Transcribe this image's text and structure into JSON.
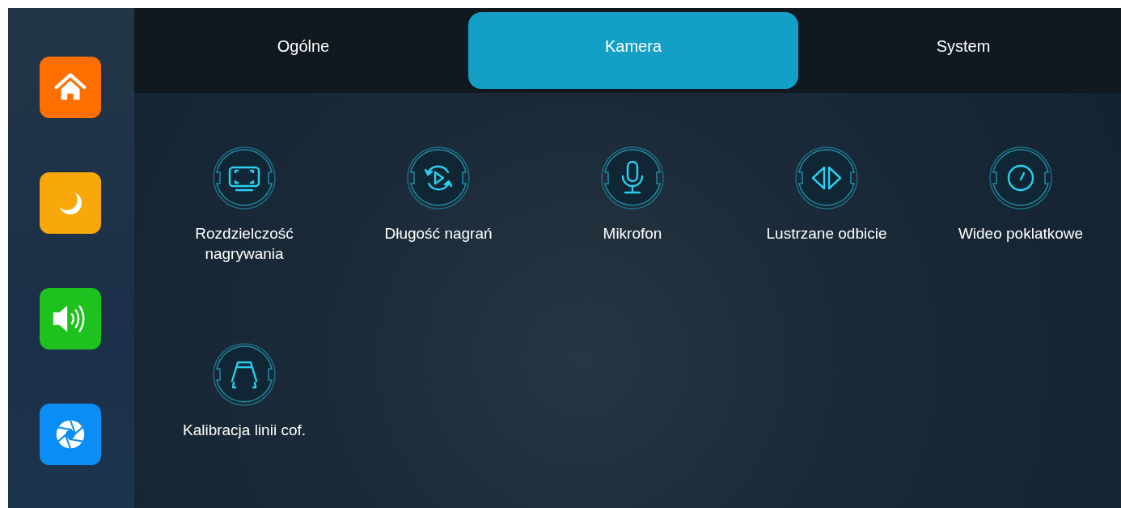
{
  "sidebar": {
    "items": [
      {
        "kind": "home",
        "color": "#ff6f00"
      },
      {
        "kind": "moon",
        "color": "#f9a80c"
      },
      {
        "kind": "sound",
        "color": "#1ec21e"
      },
      {
        "kind": "aperture",
        "color": "#0a8ef5"
      }
    ]
  },
  "tabs": [
    {
      "label": "Ogólne",
      "selected": false
    },
    {
      "label": "Kamera",
      "selected": true
    },
    {
      "label": "System",
      "selected": false
    }
  ],
  "settings": [
    {
      "kind": "resolution",
      "label": "Rozdzielczość nagrywania"
    },
    {
      "kind": "loop",
      "label": "Długość nagrań"
    },
    {
      "kind": "microphone",
      "label": "Mikrofon"
    },
    {
      "kind": "mirror",
      "label": "Lustrzane odbicie"
    },
    {
      "kind": "timelapse",
      "label": "Wideo poklatkowe"
    },
    {
      "kind": "parking",
      "label": "Kalibracja linii cof."
    }
  ]
}
